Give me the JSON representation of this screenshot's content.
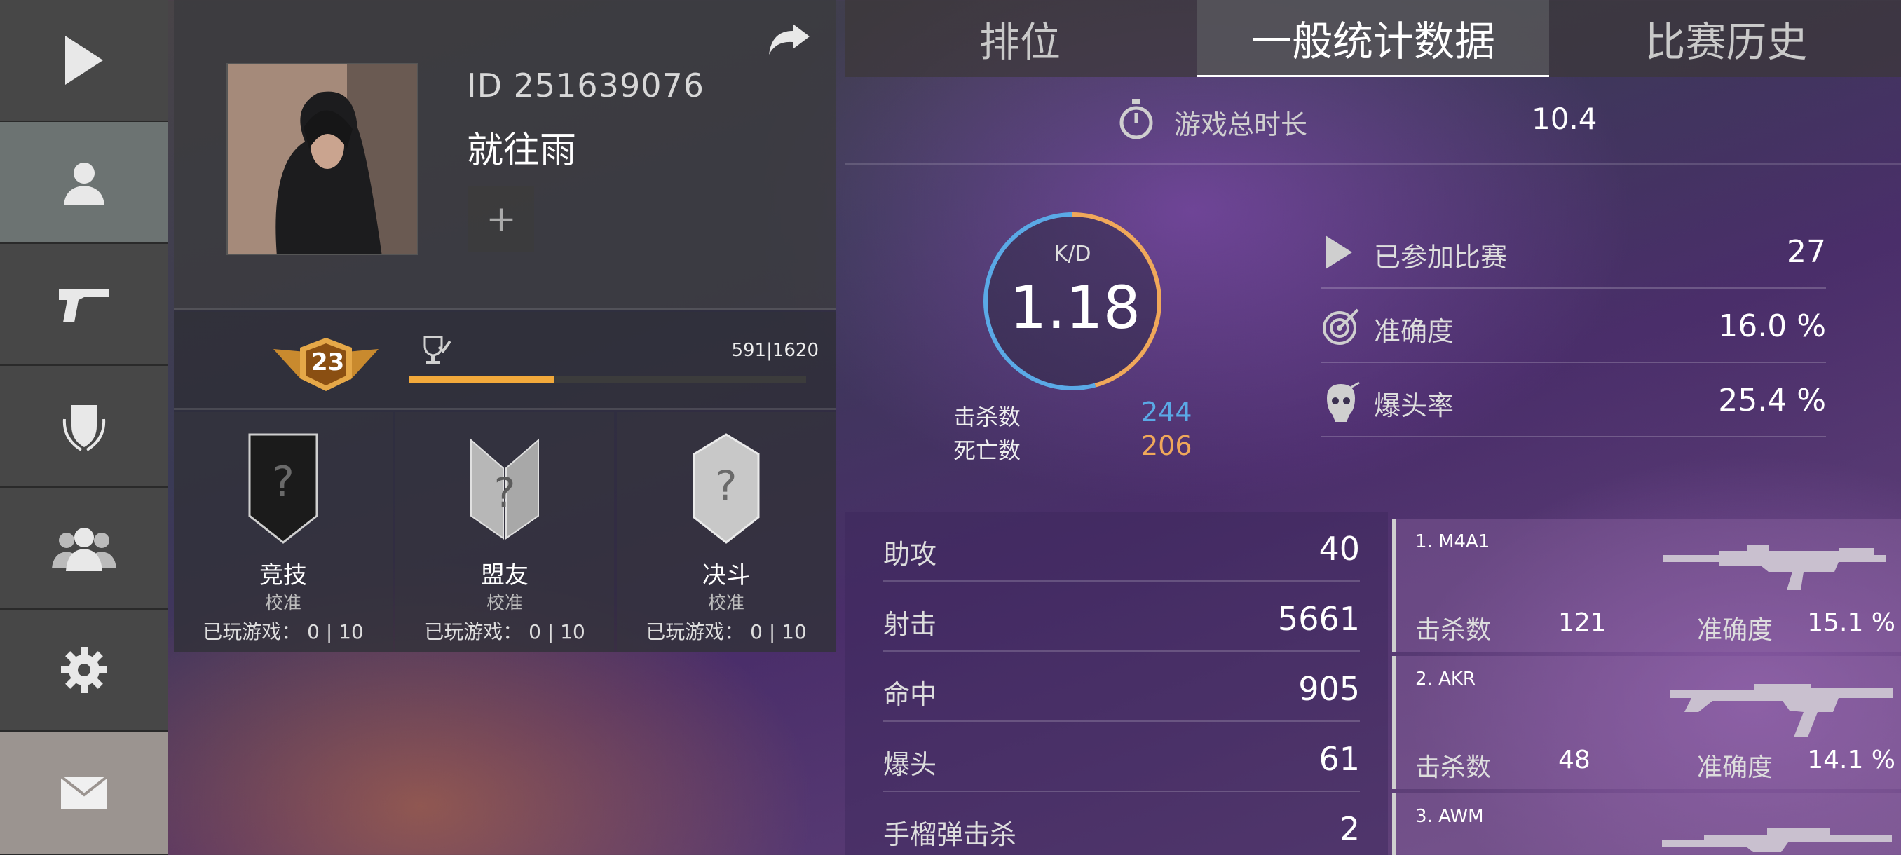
{
  "profile": {
    "id": "ID 251639076",
    "name": "就往雨",
    "add_label": "+",
    "level": "23",
    "xp_text": "591|1620",
    "xp_fraction": 0.365
  },
  "modes": [
    {
      "name": "竞技",
      "sub": "校准",
      "played": "已玩游戏： 0 | 10"
    },
    {
      "name": "盟友",
      "sub": "校准",
      "played": "已玩游戏： 0 | 10"
    },
    {
      "name": "决斗",
      "sub": "校准",
      "played": "已玩游戏： 0 | 10"
    }
  ],
  "tabs": [
    "排位",
    "一般统计数据",
    "比赛历史"
  ],
  "active_tab": "一般统计数据",
  "stats": {
    "playtime_label": "游戏总时长",
    "playtime_value": "10.4",
    "kd_label": "K/D",
    "kd_value": "1.18",
    "kills_label": "击杀数",
    "kills_value": "244",
    "deaths_label": "死亡数",
    "deaths_value": "206",
    "matches_label": "已参加比赛",
    "matches_value": "27",
    "accuracy_label": "准确度",
    "accuracy_value": "16.0 %",
    "headshot_rate_label": "爆头率",
    "headshot_rate_value": "25.4 %"
  },
  "details": [
    {
      "label": "助攻",
      "value": "40"
    },
    {
      "label": "射击",
      "value": "5661"
    },
    {
      "label": "命中",
      "value": "905"
    },
    {
      "label": "爆头",
      "value": "61"
    },
    {
      "label": "手榴弹击杀",
      "value": "2"
    }
  ],
  "weapons": [
    {
      "name": "1. M4A1",
      "kills_label": "击杀数",
      "kills": "121",
      "acc_label": "准确度",
      "acc": "15.1 %"
    },
    {
      "name": "2. AKR",
      "kills_label": "击杀数",
      "kills": "48",
      "acc_label": "准确度",
      "acc": "14.1 %"
    },
    {
      "name": "3. AWM",
      "kills_label": "",
      "kills": "",
      "acc_label": "",
      "acc": ""
    }
  ],
  "colors": {
    "kills": "#5aa9e6",
    "deaths": "#f0a85a",
    "xp_bar": "#f2a93b"
  },
  "icons": [
    "play-icon",
    "user-icon",
    "pistol-icon",
    "shield-laurel-icon",
    "friends-icon",
    "gear-icon",
    "mail-icon",
    "share-icon",
    "stopwatch-icon",
    "target-icon",
    "headshot-icon",
    "trophy-icon",
    "level-badge-icon"
  ]
}
